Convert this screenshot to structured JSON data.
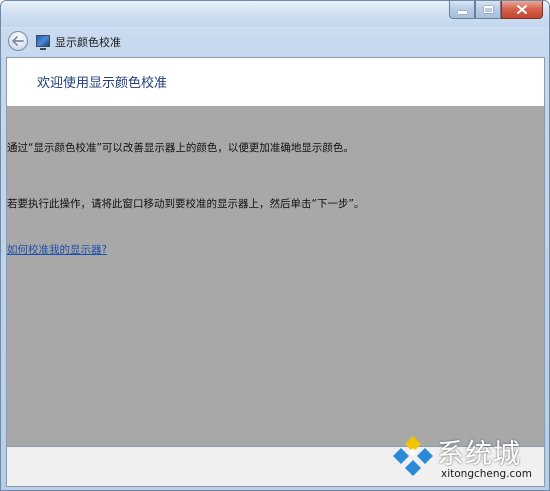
{
  "window": {
    "title": "显示颜色校准"
  },
  "page": {
    "heading": "欢迎使用显示颜色校准",
    "paragraph1": "通过“显示颜色校准”可以改善显示器上的颜色，以便更加准确地显示颜色。",
    "paragraph2": "若要执行此操作，请将此窗口移动到要校准的显示器上，然后单击“下一步”。",
    "help_link": "如何校准我的显示器?"
  },
  "icons": {
    "back": "back-arrow-icon",
    "app": "monitor-icon",
    "minimize": "minimize-icon",
    "maximize": "maximize-icon",
    "close": "close-icon"
  },
  "watermark": {
    "brand": "系统城",
    "site": "xitongcheng.com"
  },
  "colors": {
    "content_bg": "#a8a8a8",
    "heading": "#1f3d7a",
    "link": "#1d4fb0",
    "close_button": "#c24530"
  }
}
